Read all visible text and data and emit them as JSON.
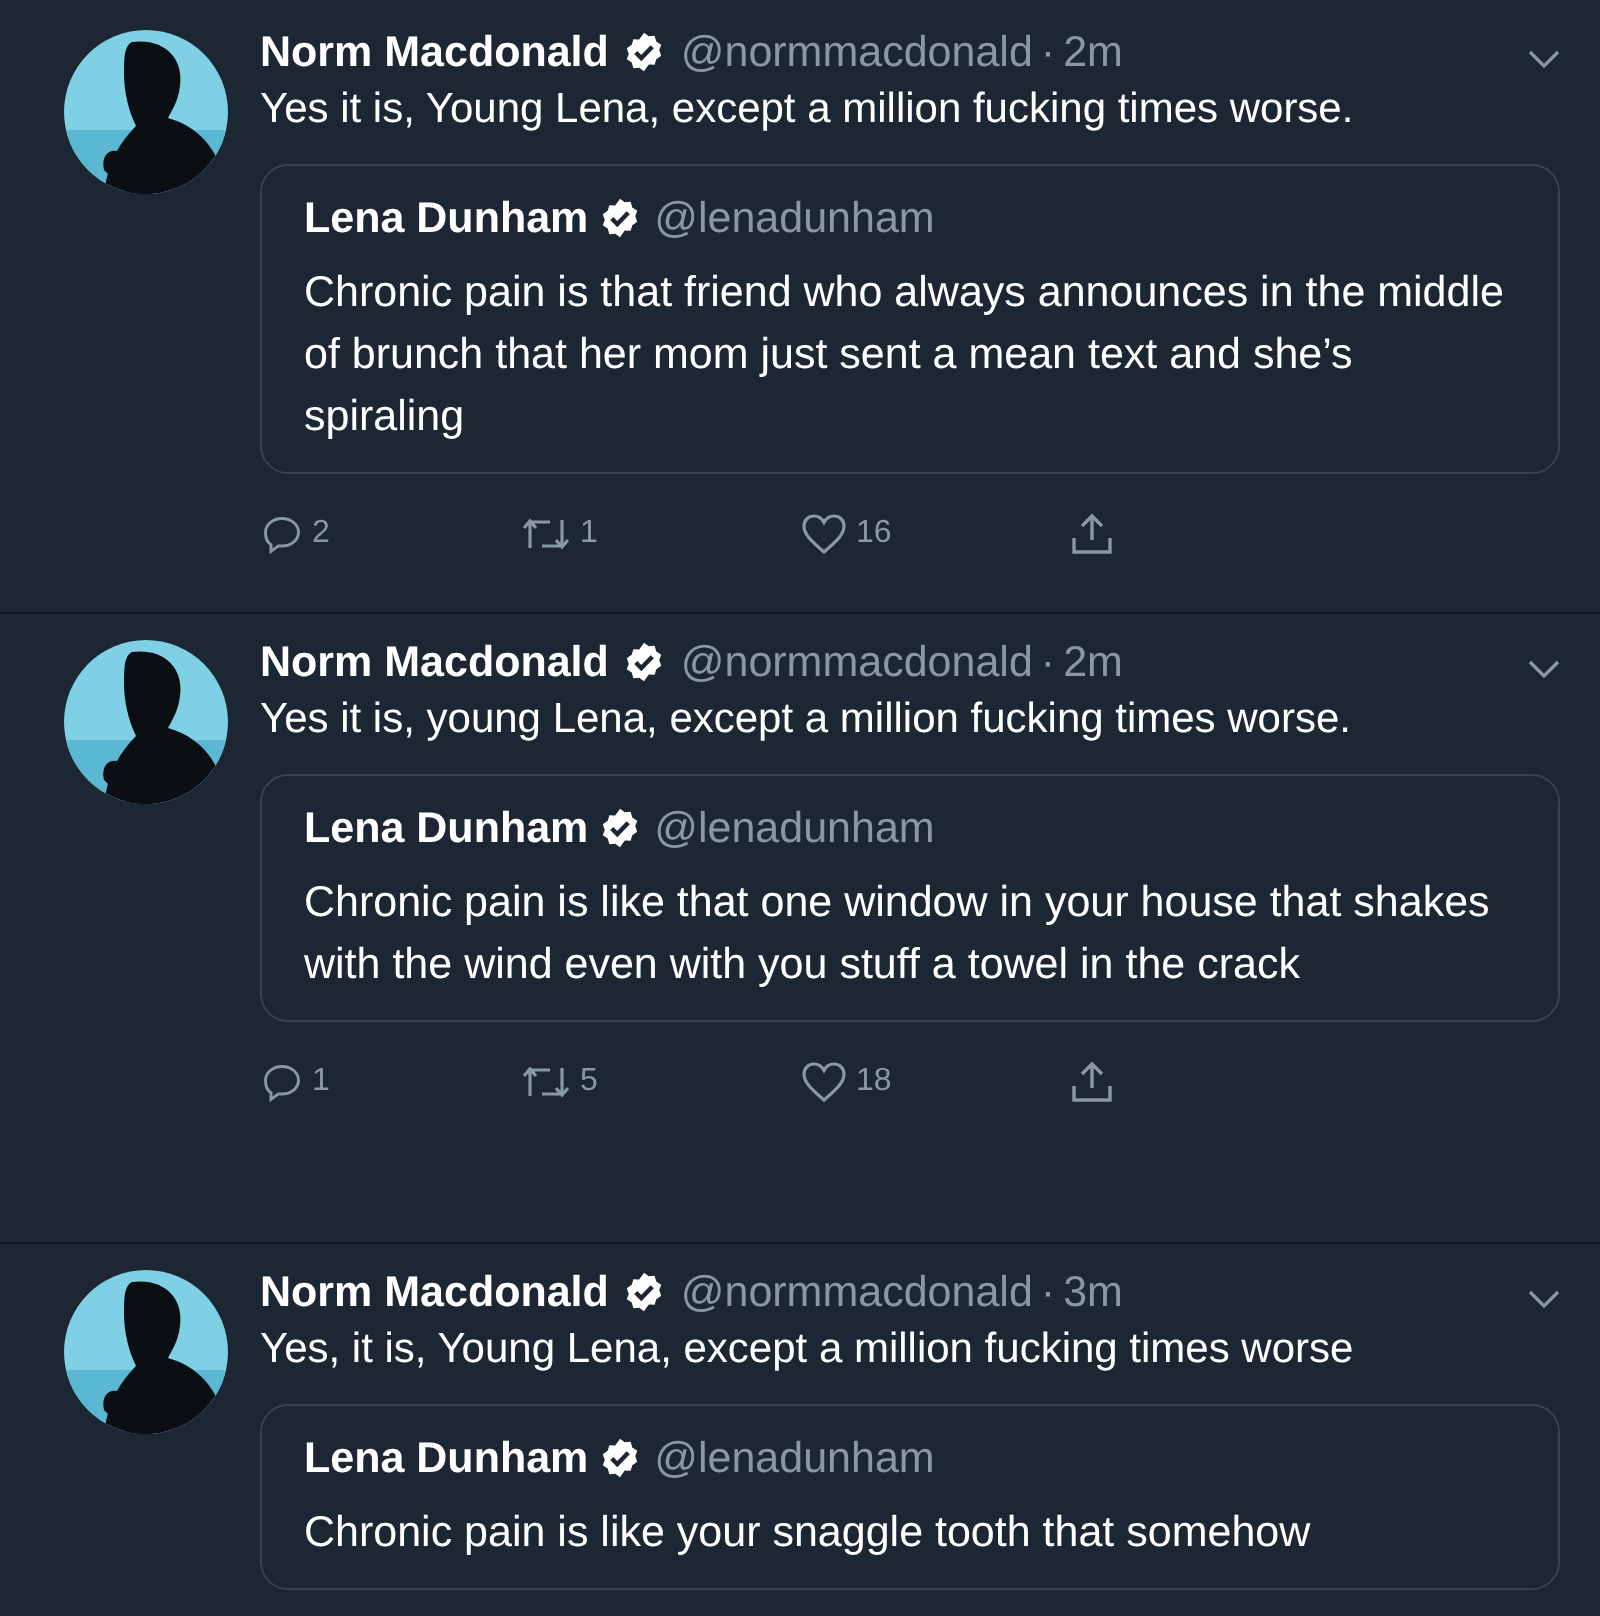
{
  "tweets": [
    {
      "author": "Norm Macdonald",
      "handle": "@normmacdonald",
      "separator": "·",
      "time": "2m",
      "text": "Yes it is, Young Lena, except a million fucking times worse.",
      "quote": {
        "author": "Lena Dunham",
        "handle": "@lenadunham",
        "text": "Chronic pain is that friend who always announces in the middle of brunch that her mom just sent a mean text and she’s spiraling"
      },
      "actions": {
        "replies": "2",
        "retweets": "1",
        "likes": "16"
      }
    },
    {
      "author": "Norm Macdonald",
      "handle": "@normmacdonald",
      "separator": "·",
      "time": "2m",
      "text": "Yes it is, young Lena, except a million fucking times worse.",
      "quote": {
        "author": "Lena Dunham",
        "handle": "@lenadunham",
        "text": "Chronic pain is like that one window in your house that shakes with the wind even with you stuff a towel in the crack"
      },
      "actions": {
        "replies": "1",
        "retweets": "5",
        "likes": "18"
      }
    },
    {
      "author": "Norm Macdonald",
      "handle": "@normmacdonald",
      "separator": "·",
      "time": "3m",
      "text": "Yes, it is, Young Lena, except a million fucking times worse",
      "quote": {
        "author": "Lena Dunham",
        "handle": "@lenadunham",
        "text": "Chronic pain is like your snaggle tooth that somehow"
      }
    }
  ]
}
